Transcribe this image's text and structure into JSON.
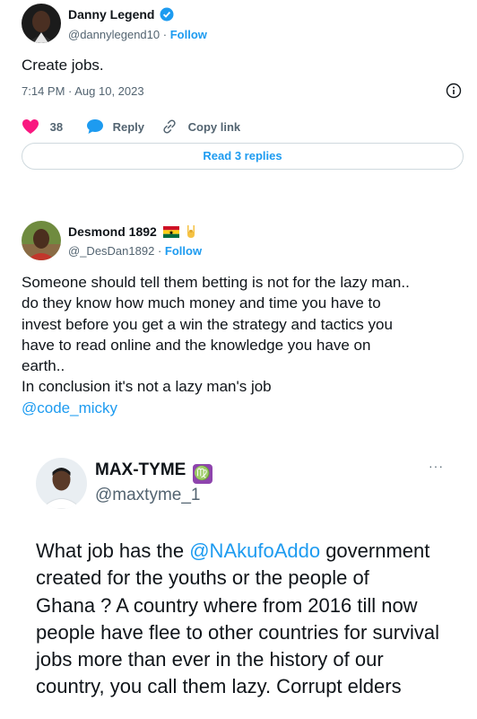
{
  "tweet1": {
    "name": "Danny Legend",
    "handle": "@dannylegend10",
    "sep": "·",
    "follow": "Follow",
    "text": "Create jobs.",
    "time": "7:14 PM · Aug 10, 2023",
    "likes": "38",
    "reply": "Reply",
    "copy": "Copy link",
    "read_replies": "Read 3 replies"
  },
  "tweet2": {
    "name": "Desmond 1892",
    "handle": "@_DesDan1892",
    "sep": "·",
    "follow": "Follow",
    "lines": [
      "Someone should tell them betting is not for the lazy man..",
      "do they know how much money and time you have to",
      "invest before you get a win the strategy and tactics you",
      "have to read online and the knowledge you have on",
      "earth..",
      "In conclusion it's not a lazy man's job"
    ],
    "mention": "@code_micky"
  },
  "tweet3": {
    "name": "MAX-TYME",
    "zodiac": "♍",
    "handle": "@maxtyme_1",
    "more": "···",
    "line1_pre": "What job has the ",
    "line1_mention": "@NAkufoAddo",
    "line1_post": " government",
    "lines": [
      "created for the youths or the people of",
      "Ghana ? A country where from 2016 till now",
      "people have flee to other countries for survival",
      "jobs more than ever in the history of our",
      "country, you call them lazy. Corrupt elders"
    ]
  },
  "colors": {
    "accent": "#1d9bf0",
    "like": "#f91880",
    "text": "#0f1419",
    "muted": "#536471"
  }
}
